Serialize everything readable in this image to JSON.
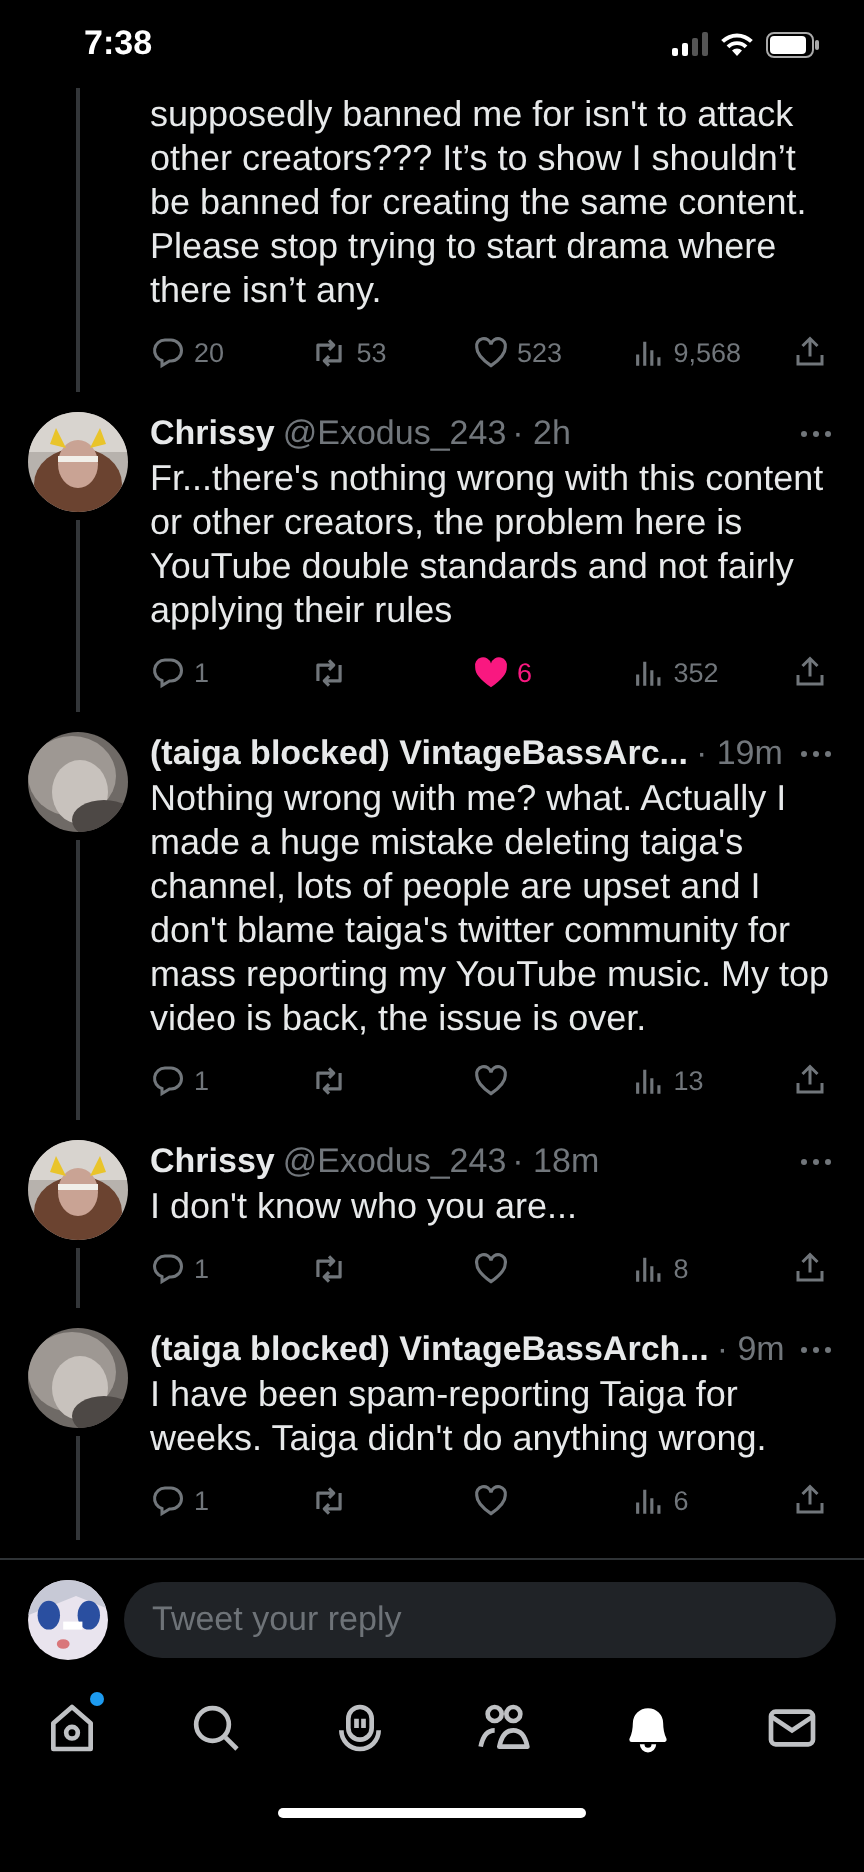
{
  "status_bar": {
    "time": "7:38"
  },
  "tweets": [
    {
      "kind": "continuation",
      "text": "supposedly banned me for isn't to attack other creators??? It’s to show I shouldn’t be banned for creating the same content. Please stop trying to start drama where there isn’t any.",
      "replies": "20",
      "retweets": "53",
      "likes": "523",
      "liked": false,
      "views": "9,568"
    },
    {
      "kind": "reply",
      "name": "Chrissy",
      "handle": "@Exodus_243",
      "time": "· 2h",
      "text": "Fr...there's nothing wrong with this content or other creators, the problem here is YouTube double standards and not fairly applying their rules",
      "replies": "1",
      "likes": "6",
      "liked": true,
      "views": "352"
    },
    {
      "kind": "reply",
      "name": "(taiga blocked) VintageBassArc...",
      "time": "· 19m",
      "text": "Nothing wrong with me? what. Actually I made a huge mistake deleting taiga's channel, lots of people are upset and I don't blame taiga's twitter community for mass reporting my YouTube music. My top video is back, the issue is over.",
      "replies": "1",
      "liked": false,
      "views": "13"
    },
    {
      "kind": "reply",
      "name": "Chrissy",
      "handle": "@Exodus_243",
      "time": "· 18m",
      "text": "I don't know who you are...",
      "replies": "1",
      "liked": false,
      "views": "8"
    },
    {
      "kind": "reply",
      "name": "(taiga blocked) VintageBassArch...",
      "time": "· 9m",
      "text": "I have been spam-reporting Taiga for weeks. Taiga didn't do anything wrong.",
      "replies": "1",
      "liked": false,
      "views": "6"
    }
  ],
  "composer": {
    "placeholder": "Tweet your reply"
  },
  "tab_bar": [
    {
      "kind": "home",
      "selected": false,
      "dot": true
    },
    {
      "kind": "search",
      "selected": false,
      "dot": false
    },
    {
      "kind": "spaces",
      "selected": false,
      "dot": false
    },
    {
      "kind": "communities",
      "selected": false,
      "dot": false
    },
    {
      "kind": "notifications",
      "selected": true,
      "dot": false
    },
    {
      "kind": "messages",
      "selected": false,
      "dot": false
    }
  ]
}
